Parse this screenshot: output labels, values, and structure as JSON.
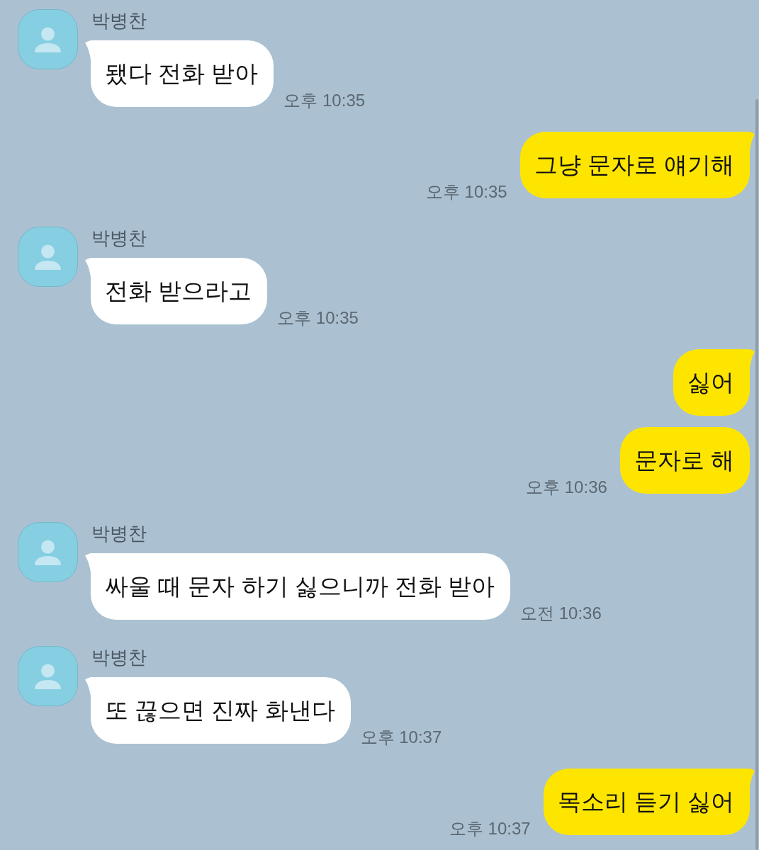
{
  "chat": {
    "groups": [
      {
        "kind": "received",
        "sender": "박병찬",
        "messages": [
          {
            "text": "됐다 전화 받아",
            "time": "오후 10:35"
          }
        ]
      },
      {
        "kind": "sent",
        "messages": [
          {
            "text": "그냥 문자로 얘기해",
            "time": "오후 10:35"
          }
        ]
      },
      {
        "kind": "received",
        "sender": "박병찬",
        "messages": [
          {
            "text": "전화 받으라고",
            "time": "오후 10:35"
          }
        ]
      },
      {
        "kind": "sent",
        "messages": [
          {
            "text": "싫어"
          },
          {
            "text": "문자로 해",
            "time": "오후 10:36"
          }
        ]
      },
      {
        "kind": "received",
        "sender": "박병찬",
        "messages": [
          {
            "text": "싸울 때 문자 하기 싫으니까 전화 받아",
            "time": "오전 10:36"
          }
        ]
      },
      {
        "kind": "received",
        "sender": "박병찬",
        "messages": [
          {
            "text": "또 끊으면 진짜 화낸다",
            "time": "오후 10:37"
          }
        ]
      },
      {
        "kind": "sent",
        "messages": [
          {
            "text": "목소리 듣기 싫어",
            "time": "오후 10:37"
          }
        ]
      }
    ]
  }
}
